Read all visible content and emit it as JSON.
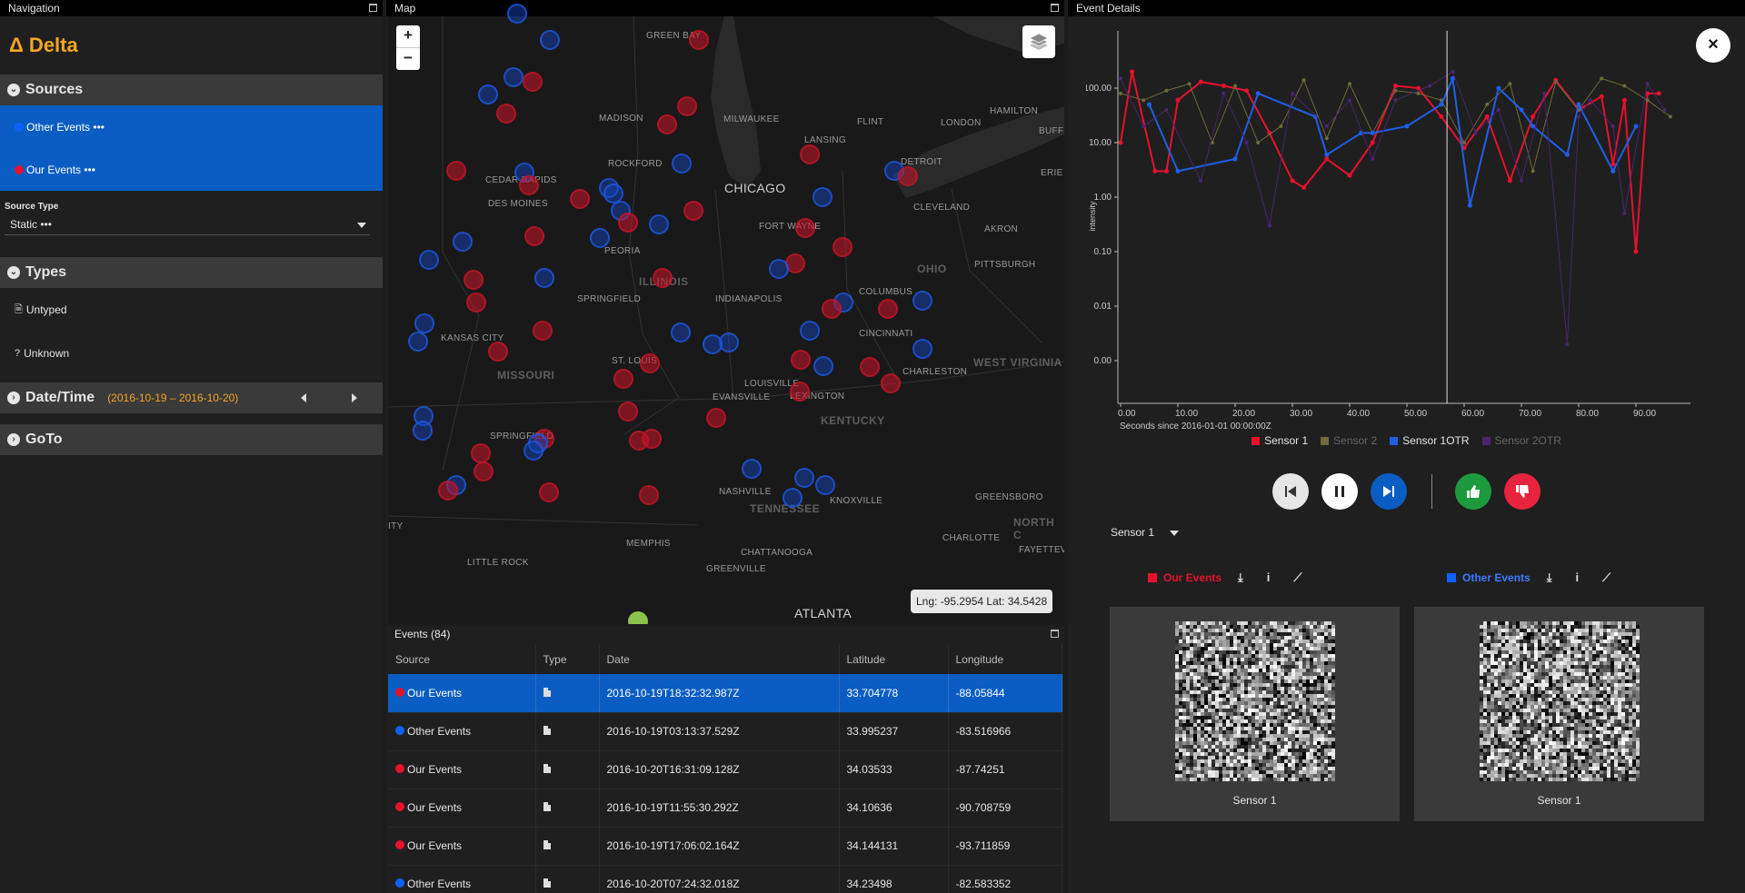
{
  "nav": {
    "title": "Navigation",
    "brand": "Δ Delta",
    "sources_label": "Sources",
    "sources": [
      {
        "label": "Other Events •••",
        "color": "#1060ff"
      },
      {
        "label": "Our Events •••",
        "color": "#e8112d"
      }
    ],
    "source_type_label": "Source Type",
    "source_type_value": "Static •••",
    "types_label": "Types",
    "types": [
      {
        "label": "Untyped",
        "icon": "file-icon"
      },
      {
        "label": "Unknown",
        "icon": "question-circle-icon"
      }
    ],
    "datetime_label": "Date/Time",
    "datetime_range": "(2016-10-19 – 2016-10-20)",
    "goto_label": "GoTo"
  },
  "map": {
    "title": "Map",
    "zoom_in": "+",
    "zoom_out": "−",
    "coords": "Lng: -95.2954 Lat: 34.5428",
    "cities": [
      "GREEN BAY",
      "MADISON",
      "MILWAUKEE",
      "FLINT",
      "HAMILTON",
      "BUFF",
      "LANSING",
      "LONDON",
      "ROCKFORD",
      "CHICAGO",
      "DETROIT",
      "CEDAR RAPIDS",
      "DES MOINES",
      "ERIE",
      "CLEVELAND",
      "AKRON",
      "FORT WAYNE",
      "PEORIA",
      "PITTSBURGH",
      "SPRINGFIELD",
      "INDIANAPOLIS",
      "COLUMBUS",
      "KANSAS CITY",
      "CINCINNATI",
      "ST. LOUIS",
      "CHARLESTON",
      "LOUISVILLE",
      "EVANSVILLE",
      "LEXINGTON",
      "SPRINGFIELD",
      "NASHVILLE",
      "KNOXVILLE",
      "GREENSBORO",
      "MEMPHIS",
      "CHARLOTTE",
      "LITTLE ROCK",
      "CHATTANOOGA",
      "FAYETTEV",
      "GREENVILLE",
      "ATLANTA",
      "ITY"
    ],
    "states": [
      "ILLINOIS",
      "MISSOURI",
      "OHIO",
      "WEST VIRGINIA",
      "KENTUCKY",
      "TENNESSEE",
      "NORTH C"
    ]
  },
  "events": {
    "title": "Events (84)",
    "columns": [
      "Source",
      "Type",
      "Date",
      "Latitude",
      "Longitude"
    ],
    "rows": [
      {
        "source": "Our Events",
        "color": "red",
        "date": "2016-10-19T18:32:32.987Z",
        "lat": "33.704778",
        "lng": "-88.05844"
      },
      {
        "source": "Other Events",
        "color": "blue",
        "date": "2016-10-19T03:13:37.529Z",
        "lat": "33.995237",
        "lng": "-83.516966"
      },
      {
        "source": "Our Events",
        "color": "red",
        "date": "2016-10-20T16:31:09.128Z",
        "lat": "34.03533",
        "lng": "-87.74251"
      },
      {
        "source": "Our Events",
        "color": "red",
        "date": "2016-10-19T11:55:30.292Z",
        "lat": "34.10636",
        "lng": "-90.708759"
      },
      {
        "source": "Our Events",
        "color": "red",
        "date": "2016-10-19T17:06:02.164Z",
        "lat": "34.144131",
        "lng": "-93.711859"
      },
      {
        "source": "Other Events",
        "color": "blue",
        "date": "2016-10-20T07:24:32.018Z",
        "lat": "34.23498",
        "lng": "-82.583352"
      }
    ]
  },
  "details": {
    "title": "Event Details",
    "close": "×",
    "sensor_select": "Sensor 1",
    "our_events_label": "Our Events",
    "other_events_label": "Other Events",
    "card_caption_left": "Sensor 1",
    "card_caption_right": "Sensor 1"
  },
  "chart_data": {
    "type": "line",
    "xlabel": "Seconds since 2016-01-01 00:00:00Z",
    "ylabel": "intensity",
    "yscale": "log",
    "yticks": [
      "100.00",
      "10.00",
      "1.00",
      "0.10",
      "0.01",
      "0.00"
    ],
    "xticks": [
      "0.00",
      "10.00",
      "20.00",
      "30.00",
      "40.00",
      "50.00",
      "60.00",
      "70.00",
      "80.00",
      "90.00"
    ],
    "xlim": [
      0,
      100
    ],
    "cursor_x": 57,
    "legend": [
      {
        "name": "Sensor 1",
        "color": "#e8112d",
        "active": true
      },
      {
        "name": "Sensor 2",
        "color": "#6e6a3a",
        "active": false
      },
      {
        "name": "Sensor 1OTR",
        "color": "#1f5fe8",
        "active": true
      },
      {
        "name": "Sensor 2OTR",
        "color": "#4a2470",
        "active": false
      }
    ],
    "series": [
      {
        "name": "Sensor 1",
        "color": "#e8112d",
        "width": 2,
        "x": [
          0,
          2,
          6,
          8,
          10,
          14,
          18,
          22,
          26,
          30,
          32,
          36,
          40,
          44,
          48,
          52,
          56,
          60,
          64,
          68,
          72,
          76,
          80,
          84,
          86,
          88,
          90,
          92,
          94
        ],
        "y": [
          10,
          200,
          3,
          3,
          60,
          130,
          110,
          90,
          15,
          2,
          1.5,
          5,
          2.5,
          10,
          110,
          100,
          30,
          8,
          30,
          2,
          30,
          140,
          40,
          70,
          4,
          60,
          0.1,
          80,
          80
        ]
      },
      {
        "name": "Sensor 2",
        "color": "#6e6a3a",
        "width": 1,
        "x": [
          0,
          4,
          8,
          12,
          16,
          20,
          24,
          28,
          32,
          36,
          40,
          44,
          48,
          52,
          56,
          60,
          64,
          68,
          72,
          76,
          80,
          84,
          88,
          92,
          96
        ],
        "y": [
          80,
          60,
          90,
          120,
          10,
          110,
          10,
          20,
          140,
          12,
          120,
          15,
          90,
          80,
          60,
          10,
          50,
          120,
          3,
          130,
          40,
          150,
          110,
          60,
          30
        ]
      },
      {
        "name": "Sensor 1OTR",
        "color": "#1f5fe8",
        "width": 2,
        "x": [
          5,
          10,
          20,
          24,
          34,
          36,
          42,
          44,
          50,
          56,
          58,
          61,
          66,
          70,
          72,
          78,
          80,
          86,
          90
        ],
        "y": [
          50,
          3,
          5,
          80,
          30,
          6,
          15,
          15,
          20,
          50,
          150,
          0.7,
          100,
          40,
          20,
          6,
          50,
          3,
          20
        ]
      },
      {
        "name": "Sensor 2OTR",
        "color": "#4a2470",
        "width": 1,
        "x": [
          0,
          4,
          8,
          14,
          18,
          22,
          26,
          30,
          36,
          40,
          44,
          48,
          54,
          58,
          62,
          66,
          70,
          74,
          78,
          80,
          82,
          86,
          88,
          92,
          95
        ],
        "y": [
          150,
          20,
          40,
          2,
          80,
          10,
          0.3,
          80,
          20,
          60,
          5,
          60,
          110,
          200,
          15,
          40,
          2,
          80,
          0.002,
          30,
          60,
          20,
          0.5,
          120,
          40
        ]
      }
    ]
  }
}
